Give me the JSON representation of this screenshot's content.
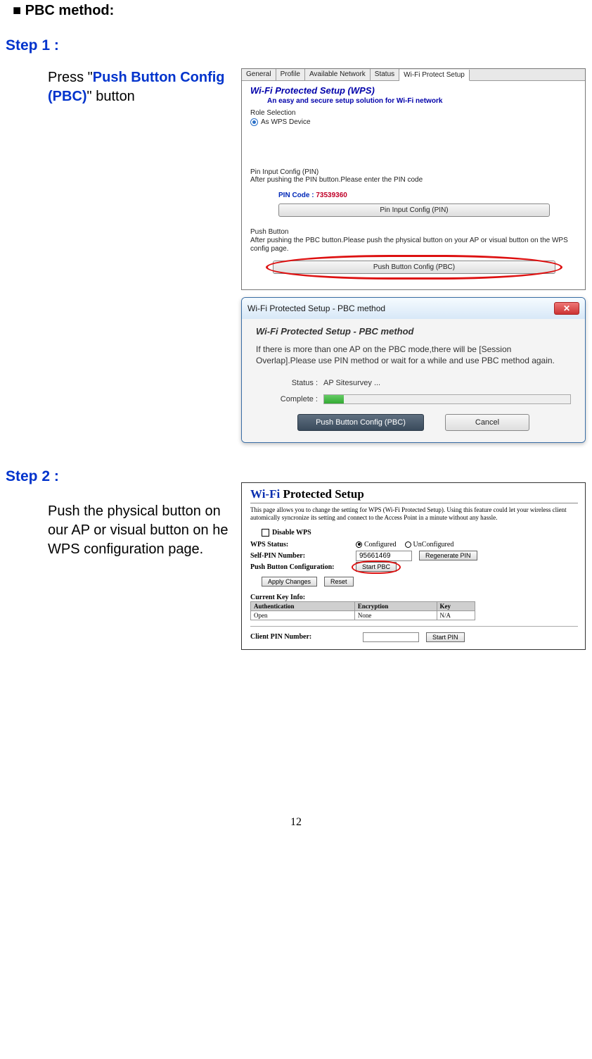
{
  "doc": {
    "heading": "■ PBC method:",
    "page_number": "12"
  },
  "step1": {
    "title": "Step 1 :",
    "instr_pre": "Press \"",
    "instr_hl": "Push Button Config (PBC)",
    "instr_post": "\" button"
  },
  "step2": {
    "title": "Step 2 :",
    "instr": "Push the physical button on our AP or visual button on he WPS configuration page."
  },
  "panel1": {
    "tabs": [
      "General",
      "Profile",
      "Available Network",
      "Status",
      "Wi-Fi Protect Setup"
    ],
    "active_tab": 4,
    "title": "Wi-Fi Protected Setup (WPS)",
    "subtitle": "An easy and secure setup solution for Wi-Fi network",
    "role_label": "Role Selection",
    "role_option": "As WPS Device",
    "pin_section_title": "Pin Input Config (PIN)",
    "pin_desc": "After pushing the PIN button.Please enter the PIN code",
    "pin_code_label": "PIN Code :",
    "pin_code_value": "73539360",
    "pin_button": "Pin Input Config (PIN)",
    "pbc_section_title": "Push Button",
    "pbc_desc": "After pushing the PBC button.Please push the physical button on your AP or visual button on the WPS config page.",
    "pbc_button": "Push Button Config (PBC)"
  },
  "dialog": {
    "title": "Wi-Fi Protected Setup - PBC method",
    "heading": "Wi-Fi Protected Setup - PBC method",
    "text": "If there is more than one AP on the PBC mode,there will be [Session Overlap].Please use PIN method or wait for a while and use PBC method again.",
    "status_label": "Status :",
    "status_value": "AP Sitesurvey ...",
    "complete_label": "Complete :",
    "btn_pbc": "Push Button Config (PBC)",
    "btn_cancel": "Cancel"
  },
  "router": {
    "title_pre": "Wi-Fi",
    "title_post": " Protected Setup",
    "desc": "This page allows you to change the setting for WPS (Wi-Fi Protected Setup). Using this feature could let your wireless client automically syncronize its setting and connect to the Access Point in a minute without any hassle.",
    "disable_label": "Disable WPS",
    "status_label": "WPS Status:",
    "status_configured": "Configured",
    "status_unconfigured": "UnConfigured",
    "selfpin_label": "Self-PIN Number:",
    "selfpin_value": "95661469",
    "regen_btn": "Regenerate PIN",
    "pbc_label": "Push Button Configuration:",
    "start_pbc_btn": "Start PBC",
    "apply_btn": "Apply Changes",
    "reset_btn": "Reset",
    "keyinfo_label": "Current Key Info:",
    "table": {
      "headers": [
        "Authentication",
        "Encryption",
        "Key"
      ],
      "row": [
        "Open",
        "None",
        "N/A"
      ]
    },
    "client_pin_label": "Client PIN Number:",
    "start_pin_btn": "Start PIN"
  }
}
